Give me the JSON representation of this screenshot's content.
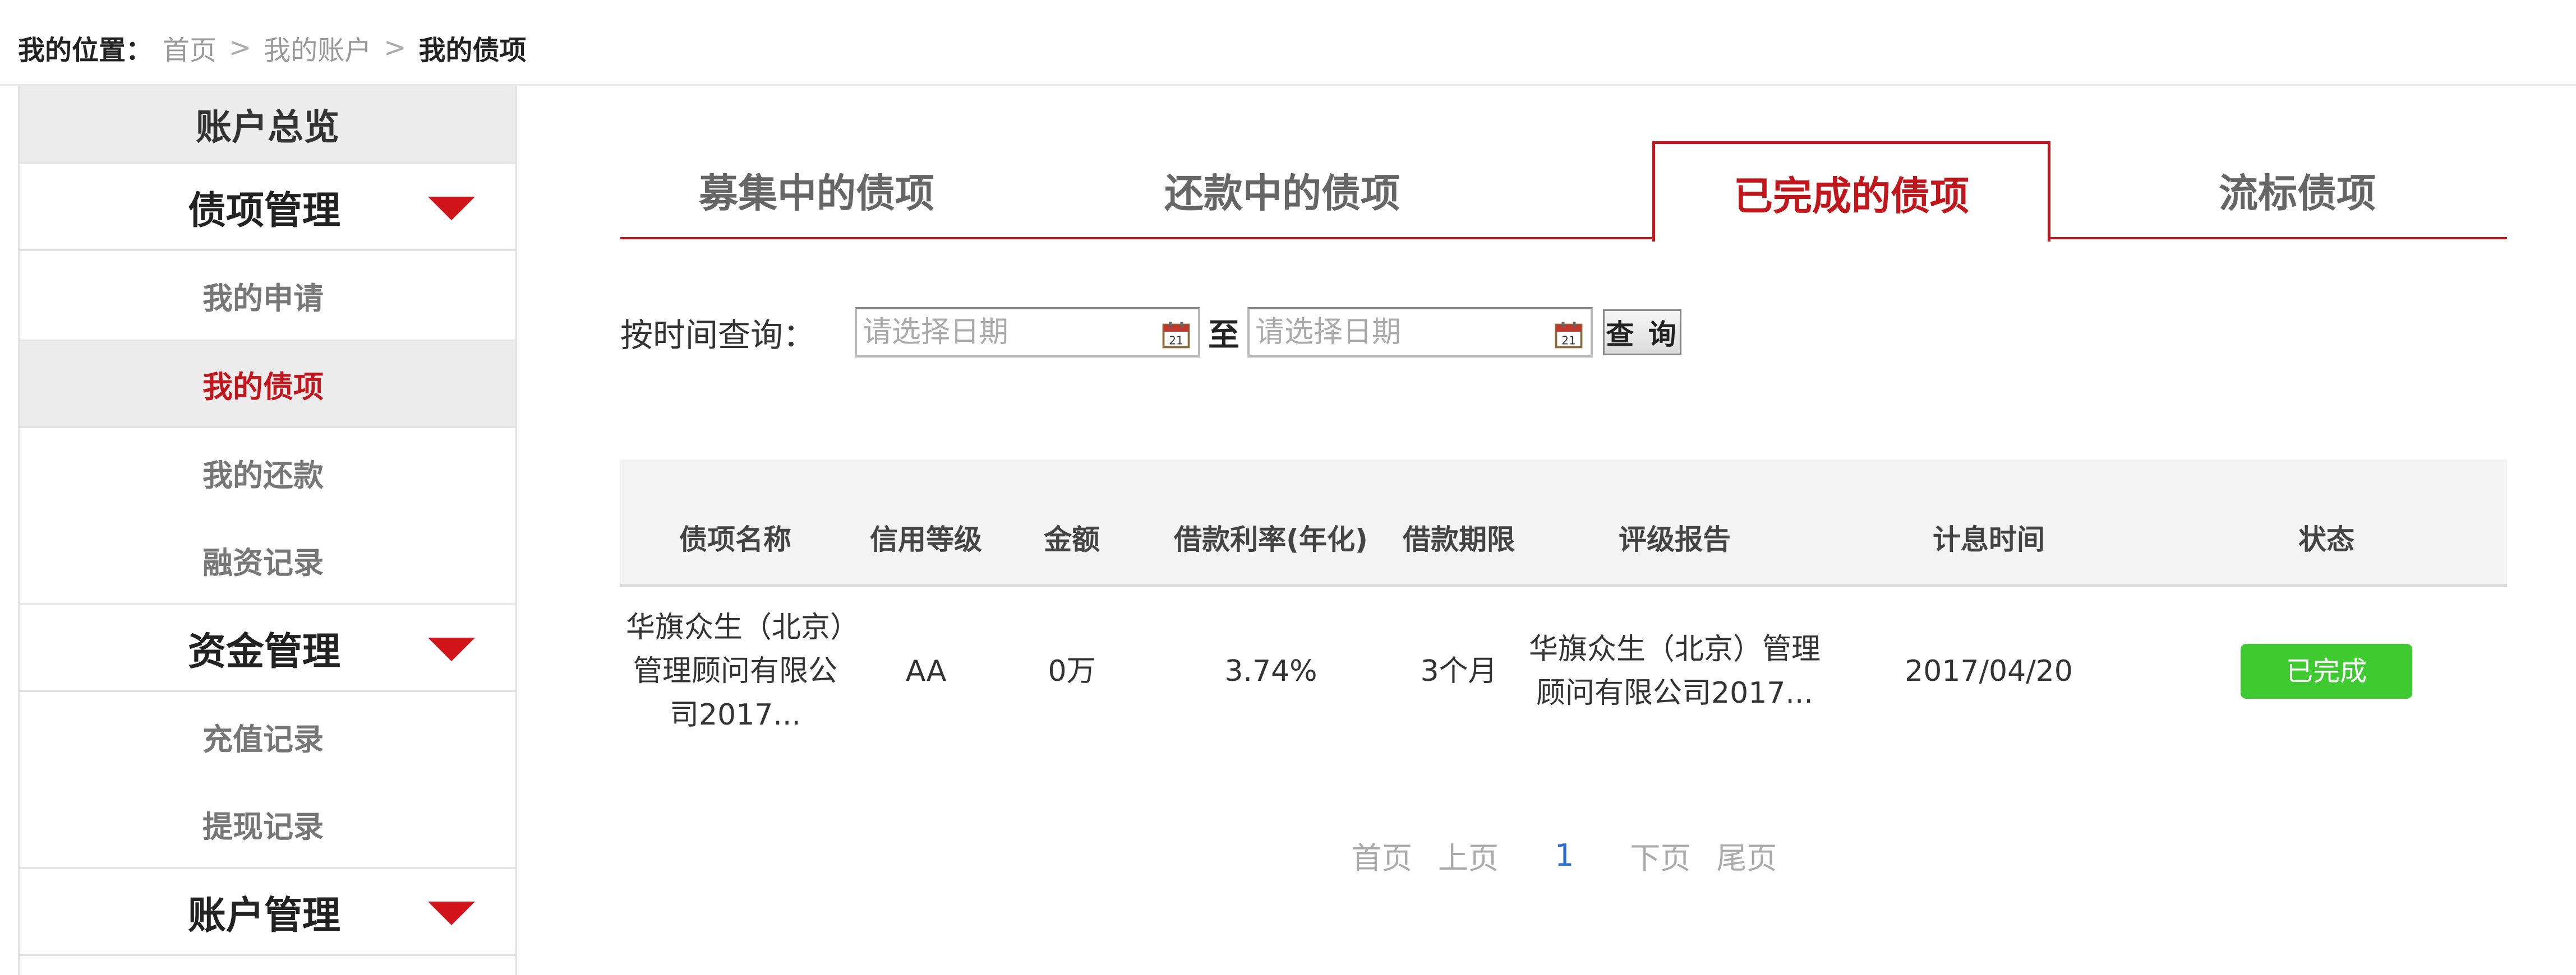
{
  "breadcrumb": {
    "label": "我的位置：",
    "home": "首页",
    "sep1": ">",
    "account": "我的账户",
    "sep2": ">",
    "current": "我的债项"
  },
  "sidebar": {
    "overview": "账户总览",
    "debt_section": "债项管理",
    "debt_items": [
      "我的申请",
      "我的债项",
      "我的还款",
      "融资记录"
    ],
    "fund_section": "资金管理",
    "fund_items": [
      "充值记录",
      "提现记录"
    ],
    "account_section": "账户管理"
  },
  "tabs": [
    "募集中的债项",
    "还款中的债项",
    "已完成的债项",
    "流标债项"
  ],
  "search": {
    "label": "按时间查询：",
    "start_placeholder": "请选择日期",
    "to": "至",
    "end_placeholder": "请选择日期",
    "button": "查 询"
  },
  "table": {
    "headers": [
      "债项名称",
      "信用等级",
      "金额",
      "借款利率(年化)",
      "借款期限",
      "评级报告",
      "计息时间",
      "状态"
    ],
    "rows": [
      {
        "name": "华旗众生（北京）管理顾问有限公司2017...",
        "rating": "AA",
        "amount": "0万",
        "rate": "3.74%",
        "term": "3个月",
        "report": "华旗众生（北京）管理顾问有限公司2017...",
        "date": "2017/04/20",
        "status": "已完成"
      }
    ]
  },
  "pager": {
    "first": "首页",
    "prev": "上页",
    "page": "1",
    "next": "下页",
    "last": "尾页"
  },
  "colors": {
    "accent": "#c0161c",
    "status_done": "#3fca32",
    "page_link": "#2b6fd6"
  }
}
